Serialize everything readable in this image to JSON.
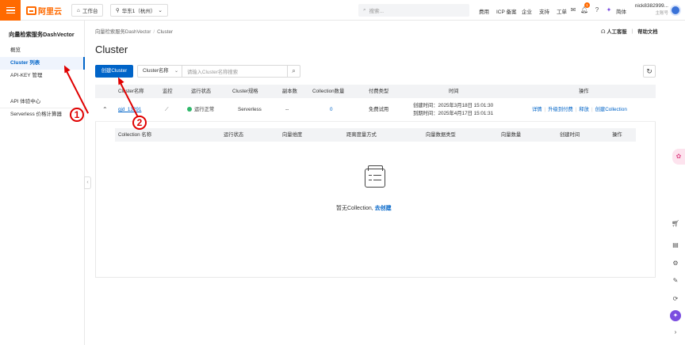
{
  "topbar": {
    "logo_text": "阿里云",
    "workbench_label": "工作台",
    "region_label": "华东1（杭州）",
    "search_placeholder": "搜索...",
    "links": [
      "费用",
      "ICP 备案",
      "企业",
      "支持",
      "工单"
    ],
    "notification_count": "1",
    "language_label": "简体",
    "user_name": "nick8382999...",
    "user_role": "主账号",
    "accent_color": "#ff6a00"
  },
  "sidebar": {
    "title": "向量检索服务DashVector",
    "items": [
      {
        "label": "概览"
      },
      {
        "label": "Cluster 列表"
      },
      {
        "label": "API-KEY 管理"
      },
      {
        "label": "API 体验中心"
      },
      {
        "label": "Serverless 价格计算器"
      }
    ],
    "active_item": "Cluster 列表"
  },
  "breadcrumb": {
    "root": "向量检索服务DashVector",
    "current": "Cluster"
  },
  "header_right": {
    "service_label": "人工客服",
    "docs_label": "帮助文档"
  },
  "page": {
    "title": "Cluster",
    "create_button": "创建Cluster",
    "filter_select": "Cluster名称",
    "filter_placeholder": "请输入Cluster名称搜索"
  },
  "table": {
    "columns": [
      "Cluster名称",
      "监控",
      "运行状态",
      "Cluster规格",
      "副本数",
      "Collection数量",
      "付费类型",
      "时间",
      "操作"
    ],
    "row": {
      "name": "gjd_13291",
      "status": "运行正常",
      "spec": "Serverless",
      "replicas": "--",
      "collection_count": "0",
      "billing": "免费试用",
      "created": "创建时间：2025年3月18日 15:01:30",
      "expires": "到期时间：2025年4月17日 15:01:31",
      "actions": [
        "详情",
        "升级到付费",
        "释放",
        "创建Collection"
      ]
    }
  },
  "subtable": {
    "columns": [
      "Collection 名称",
      "运行状态",
      "向量维度",
      "距离度量方式",
      "向量数据类型",
      "向量数量",
      "创建时间",
      "操作"
    ],
    "empty_text": "暂无Collection,",
    "empty_link": "去创建"
  },
  "annotations": {
    "marker_1": "1",
    "marker_2": "2"
  },
  "colors": {
    "primary": "#0064c8",
    "brand": "#ff6a00",
    "status_ok": "#2fb86a",
    "annotation": "#e00000"
  }
}
